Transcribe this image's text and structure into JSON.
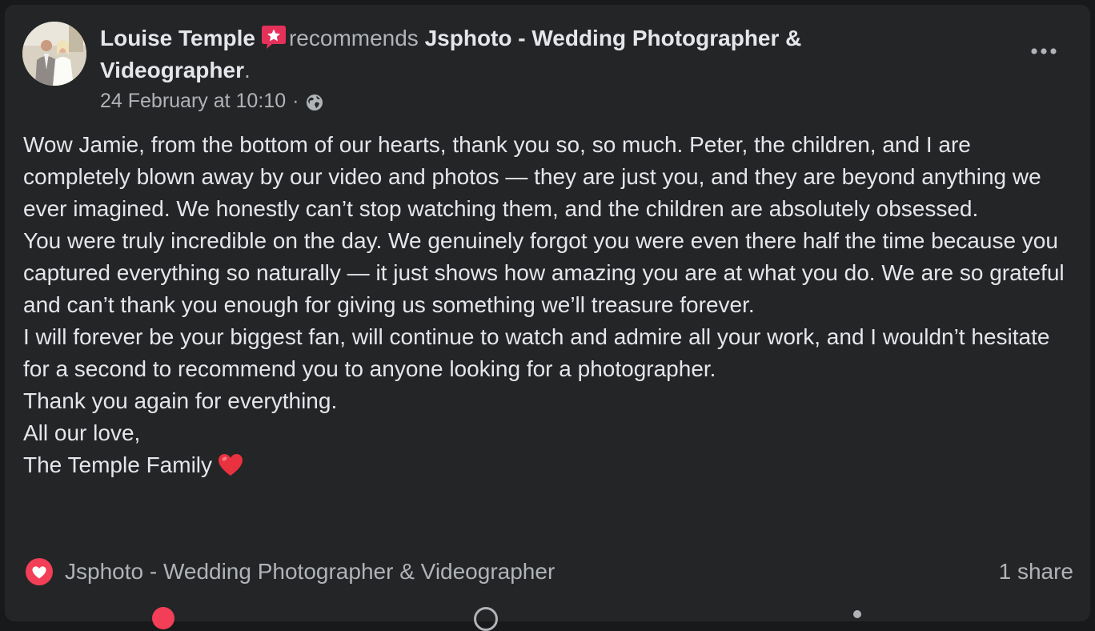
{
  "post": {
    "author": "Louise Temple",
    "badge_icon": "recommendation-star-icon",
    "action_text": "recommends",
    "page_name": "Jsphoto - Wedding Photographer & Videographer",
    "page_name_suffix": ".",
    "timestamp": "24 February at 10:10",
    "separator": "·",
    "privacy_icon": "globe-icon",
    "more_icon": "more-options-icon",
    "body_paragraphs": [
      "Wow Jamie, from the bottom of our hearts, thank you so, so much. Peter, the children, and I are completely blown away by our video and photos — they are just you, and they are beyond anything we ever imagined. We honestly can’t stop watching them, and the children are absolutely obsessed.",
      "You were truly incredible on the day. We genuinely forgot you were even there half the time because you captured everything so naturally — it just shows how amazing you are at what you do. We are so grateful and can’t thank you enough for giving us something we’ll treasure forever.",
      "I will forever be your biggest fan, will continue to watch and admire all your work, and I wouldn’t hesitate for a second to recommend you to anyone looking for a photographer.",
      "Thank you again for everything.",
      "All our love,",
      "The Temple Family"
    ],
    "closing_emoji_icon": "red-heart-emoji-icon"
  },
  "footer": {
    "reaction_icon": "love-reaction-icon",
    "reacted_by": "Jsphoto - Wedding Photographer & Videographer",
    "shares": "1 share"
  },
  "colors": {
    "background": "#18191a",
    "card": "#242526",
    "primary_text": "#e4e6eb",
    "secondary_text": "#b0b3b8",
    "love_red": "#f33e58",
    "badge_pink": "#e4315a"
  }
}
